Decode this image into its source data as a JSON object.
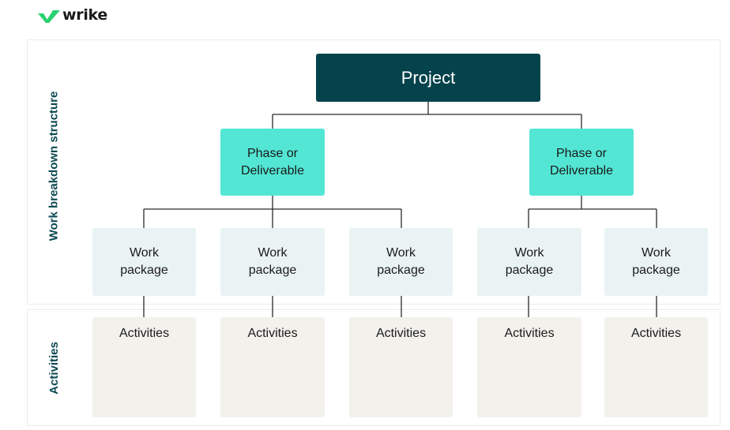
{
  "brand": {
    "name": "wrike",
    "logo_icon": "checkmark-logo-icon",
    "accent_color": "#2bd16f"
  },
  "labels": {
    "top_section": "Work breakdown structure",
    "bottom_section": "Activities"
  },
  "colors": {
    "project": "#05434c",
    "phase": "#53e6d4",
    "work_package": "#eaf3f3",
    "activities": "#f3f1ec",
    "label_text": "#0d4a52"
  },
  "tree": {
    "project": "Project",
    "phases": [
      {
        "label": "Phase or\nDeliverable",
        "work_packages": [
          {
            "label": "Work\npackage",
            "activities": "Activities"
          },
          {
            "label": "Work\npackage",
            "activities": "Activities"
          },
          {
            "label": "Work\npackage",
            "activities": "Activities"
          }
        ]
      },
      {
        "label": "Phase or\nDeliverable",
        "work_packages": [
          {
            "label": "Work\npackage",
            "activities": "Activities"
          },
          {
            "label": "Work\npackage",
            "activities": "Activities"
          }
        ]
      }
    ]
  }
}
